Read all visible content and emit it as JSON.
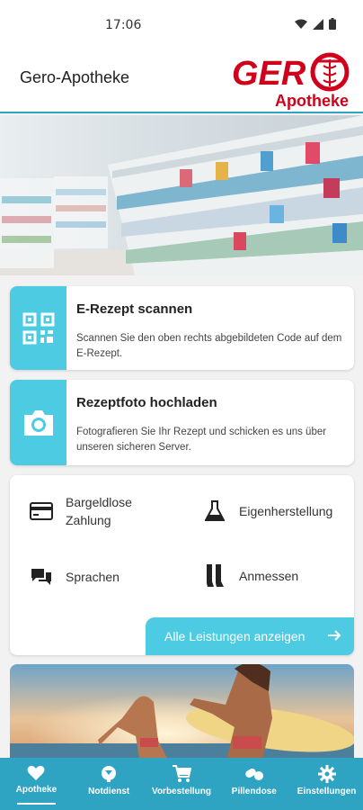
{
  "status_bar": {
    "time": "17:06"
  },
  "app_bar": {
    "title": "Gero-Apotheke",
    "logo_text": "GER",
    "logo_subtitle": "Apotheke"
  },
  "hero": {
    "image": "pharmacy-shelves"
  },
  "cards": [
    {
      "title": "E-Rezept scannen",
      "description": "Scannen Sie den oben rechts abgebildeten Code auf dem E-Rezept.",
      "icon": "qr-code-icon"
    },
    {
      "title": "Rezeptfoto hochladen",
      "description": "Fotografieren Sie Ihr Rezept und schicken es uns über unseren sicheren Server.",
      "icon": "camera-icon"
    }
  ],
  "services": {
    "items": [
      {
        "label": "Bargeldlose Zahlung",
        "icon": "credit-card-icon"
      },
      {
        "label": "Eigenherstellung",
        "icon": "flask-icon"
      },
      {
        "label": "Sprachen",
        "icon": "chat-bubbles-icon"
      },
      {
        "label": "Anmessen",
        "icon": "compression-stockings-icon"
      }
    ],
    "all_button": "Alle Leistungen anzeigen"
  },
  "promo": {
    "image": "beach-surfers"
  },
  "nav": [
    {
      "label": "Apotheke",
      "icon": "heart-icon",
      "active": true
    },
    {
      "label": "Notdienst",
      "icon": "emergency-pill-icon",
      "active": false
    },
    {
      "label": "Vorbestellung",
      "icon": "cart-icon",
      "active": false
    },
    {
      "label": "Pillendose",
      "icon": "pills-icon",
      "active": false
    },
    {
      "label": "Einstellungen",
      "icon": "gear-icon",
      "active": false
    }
  ],
  "colors": {
    "accent": "#4ccbe3",
    "nav_bg": "#2fa3c2",
    "logo_red": "#d0021b"
  }
}
